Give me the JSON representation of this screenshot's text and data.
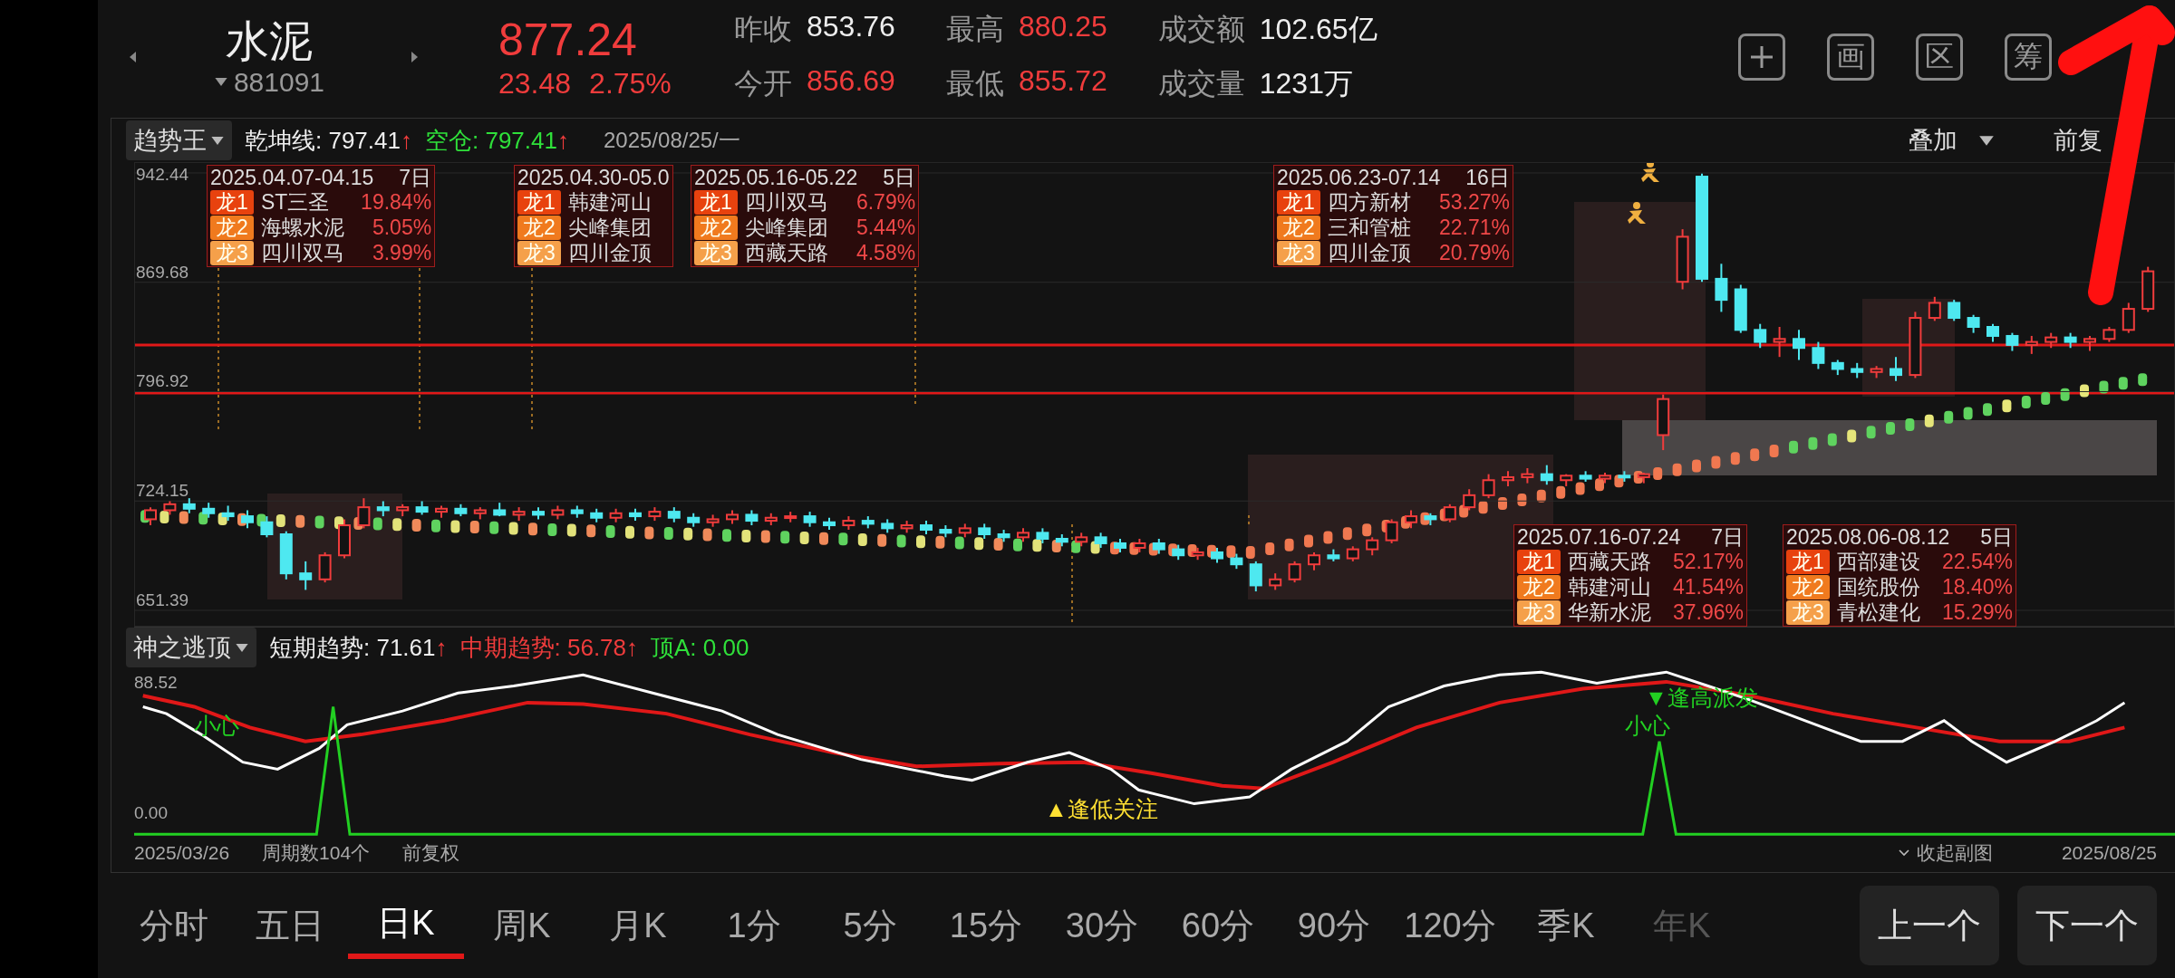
{
  "header": {
    "title": "水泥",
    "code": "881091",
    "price": "877.24",
    "change": "23.48",
    "change_pct": "2.75%",
    "stats": [
      {
        "label": "昨收",
        "value": "853.76",
        "kind": "flat"
      },
      {
        "label": "今开",
        "value": "856.69",
        "kind": "up"
      },
      {
        "label": "最高",
        "value": "880.25",
        "kind": "up"
      },
      {
        "label": "最低",
        "value": "855.72",
        "kind": "up"
      },
      {
        "label": "成交额",
        "value": "102.65亿",
        "kind": "flat"
      },
      {
        "label": "成交量",
        "value": "1231万",
        "kind": "flat"
      }
    ],
    "toolbar": [
      {
        "kind": "plus"
      },
      {
        "kind": "text",
        "label": "画"
      },
      {
        "kind": "text",
        "label": "区"
      },
      {
        "kind": "text",
        "label": "筹"
      }
    ]
  },
  "main_chart": {
    "indicator": "趋势王",
    "values": [
      {
        "label": "乾坤线:",
        "value": "797.41",
        "arrow": "↑",
        "kind": "white"
      },
      {
        "label": "空仓:",
        "value": "797.41",
        "arrow": "↑",
        "kind": "green"
      }
    ],
    "date": "2025/08/25/一",
    "overlay": "叠加",
    "adjust": "前复",
    "chart_data": {
      "type": "candlestick",
      "ylim": [
        640.54,
        949.67
      ],
      "yticks": [
        942.44,
        869.68,
        796.92,
        724.15,
        651.39
      ],
      "grid": true,
      "ohlc": [
        [
          712,
          720,
          708,
          718
        ],
        [
          718,
          724,
          715,
          722
        ],
        [
          722,
          726,
          716,
          719
        ],
        [
          719,
          723,
          713,
          716
        ],
        [
          716,
          721,
          711,
          714
        ],
        [
          714,
          718,
          706,
          710
        ],
        [
          710,
          714,
          700,
          702
        ],
        [
          702,
          704,
          672,
          676
        ],
        [
          676,
          684,
          665,
          672
        ],
        [
          672,
          690,
          670,
          688
        ],
        [
          688,
          712,
          686,
          708
        ],
        [
          708,
          726,
          706,
          720
        ],
        [
          720,
          724,
          714,
          718
        ],
        [
          718,
          722,
          714,
          720
        ],
        [
          720,
          724,
          715,
          717
        ],
        [
          717,
          721,
          713,
          719
        ],
        [
          719,
          722,
          714,
          716
        ],
        [
          716,
          720,
          712,
          718
        ],
        [
          718,
          723,
          714,
          715
        ],
        [
          715,
          720,
          711,
          717
        ],
        [
          717,
          720,
          712,
          715
        ],
        [
          715,
          721,
          712,
          718
        ],
        [
          718,
          721,
          713,
          716
        ],
        [
          716,
          719,
          710,
          713
        ],
        [
          713,
          719,
          710,
          716
        ],
        [
          716,
          719,
          711,
          714
        ],
        [
          714,
          720,
          711,
          717
        ],
        [
          717,
          720,
          710,
          713
        ],
        [
          713,
          716,
          707,
          710
        ],
        [
          710,
          715,
          707,
          712
        ],
        [
          712,
          718,
          709,
          715
        ],
        [
          715,
          718,
          708,
          711
        ],
        [
          711,
          716,
          708,
          713
        ],
        [
          713,
          717,
          710,
          714
        ],
        [
          714,
          717,
          707,
          710
        ],
        [
          710,
          713,
          705,
          708
        ],
        [
          708,
          714,
          705,
          711
        ],
        [
          711,
          714,
          706,
          709
        ],
        [
          709,
          712,
          703,
          706
        ],
        [
          706,
          711,
          703,
          708
        ],
        [
          708,
          711,
          702,
          705
        ],
        [
          705,
          708,
          700,
          703
        ],
        [
          703,
          709,
          700,
          706
        ],
        [
          706,
          709,
          699,
          702
        ],
        [
          702,
          705,
          697,
          700
        ],
        [
          700,
          706,
          697,
          703
        ],
        [
          703,
          706,
          696,
          699
        ],
        [
          699,
          702,
          694,
          697
        ],
        [
          697,
          703,
          694,
          700
        ],
        [
          700,
          703,
          693,
          696
        ],
        [
          696,
          699,
          690,
          693
        ],
        [
          693,
          699,
          690,
          696
        ],
        [
          696,
          699,
          689,
          692
        ],
        [
          692,
          695,
          685,
          688
        ],
        [
          688,
          693,
          685,
          690
        ],
        [
          690,
          693,
          683,
          686
        ],
        [
          686,
          689,
          679,
          682
        ],
        [
          682,
          684,
          664,
          668
        ],
        [
          668,
          676,
          665,
          672
        ],
        [
          672,
          684,
          670,
          682
        ],
        [
          682,
          690,
          678,
          688
        ],
        [
          688,
          692,
          684,
          686
        ],
        [
          686,
          694,
          684,
          692
        ],
        [
          692,
          700,
          688,
          698
        ],
        [
          698,
          712,
          696,
          710
        ],
        [
          710,
          718,
          706,
          714
        ],
        [
          714,
          716,
          708,
          712
        ],
        [
          712,
          722,
          710,
          720
        ],
        [
          720,
          732,
          718,
          728
        ],
        [
          728,
          742,
          726,
          738
        ],
        [
          738,
          744,
          734,
          740
        ],
        [
          740,
          746,
          736,
          742
        ],
        [
          742,
          748,
          735,
          738
        ],
        [
          738,
          742,
          734,
          741
        ],
        [
          741,
          744,
          737,
          739
        ],
        [
          739,
          743,
          736,
          741
        ],
        [
          741,
          744,
          737,
          740
        ],
        [
          740,
          743,
          736,
          742
        ],
        [
          768,
          795,
          758,
          792
        ],
        [
          870,
          905,
          865,
          900
        ],
        [
          940,
          942,
          870,
          872
        ],
        [
          872,
          882,
          850,
          858
        ],
        [
          865,
          868,
          836,
          838
        ],
        [
          838,
          842,
          826,
          830
        ],
        [
          830,
          840,
          820,
          832
        ],
        [
          832,
          838,
          818,
          826
        ],
        [
          826,
          830,
          812,
          816
        ],
        [
          816,
          818,
          808,
          812
        ],
        [
          812,
          816,
          806,
          810
        ],
        [
          810,
          814,
          806,
          812
        ],
        [
          812,
          820,
          804,
          808
        ],
        [
          808,
          850,
          806,
          846
        ],
        [
          846,
          860,
          844,
          856
        ],
        [
          856,
          858,
          844,
          846
        ],
        [
          846,
          848,
          836,
          840
        ],
        [
          840,
          842,
          830,
          834
        ],
        [
          834,
          836,
          824,
          828
        ],
        [
          828,
          834,
          822,
          830
        ],
        [
          830,
          836,
          826,
          833
        ],
        [
          833,
          836,
          826,
          830
        ],
        [
          830,
          834,
          824,
          832
        ],
        [
          832,
          840,
          830,
          838
        ],
        [
          838,
          856,
          836,
          852
        ],
        [
          852,
          880,
          850,
          877
        ]
      ]
    },
    "dragon_boxes": [
      {
        "range": "2025.04.07-04.15",
        "days": "7日",
        "rows": [
          {
            "rank": "龙1",
            "name": "ST三圣",
            "pct": "19.84%"
          },
          {
            "rank": "龙2",
            "name": "海螺水泥",
            "pct": "5.05%"
          },
          {
            "rank": "龙3",
            "name": "四川双马",
            "pct": "3.99%"
          }
        ]
      },
      {
        "range": "2025.04.30-05.0",
        "rows": [
          {
            "rank": "龙1",
            "name": "韩建河山"
          },
          {
            "rank": "龙2",
            "name": "尖峰集团"
          },
          {
            "rank": "龙3",
            "name": "四川金顶"
          }
        ]
      },
      {
        "range": "2025.05.16-05.22",
        "days": "5日",
        "rows": [
          {
            "rank": "龙1",
            "name": "四川双马",
            "pct": "6.79%"
          },
          {
            "rank": "龙2",
            "name": "尖峰集团",
            "pct": "5.44%"
          },
          {
            "rank": "龙3",
            "name": "西藏天路",
            "pct": "4.58%"
          }
        ]
      },
      {
        "range": "2025.06.23-07.14",
        "days": "16日",
        "rows": [
          {
            "rank": "龙1",
            "name": "四方新材",
            "pct": "53.27%"
          },
          {
            "rank": "龙2",
            "name": "三和管桩",
            "pct": "22.71%"
          },
          {
            "rank": "龙3",
            "name": "四川金顶",
            "pct": "20.79%"
          }
        ]
      },
      {
        "range": "2025.07.16-07.24",
        "days": "7日",
        "rows": [
          {
            "rank": "龙1",
            "name": "西藏天路",
            "pct": "52.17%"
          },
          {
            "rank": "龙2",
            "name": "韩建河山",
            "pct": "41.54%"
          },
          {
            "rank": "龙3",
            "name": "华新水泥",
            "pct": "37.96%"
          }
        ]
      },
      {
        "range": "2025.08.06-08.12",
        "days": "5日",
        "rows": [
          {
            "rank": "龙1",
            "name": "西部建设",
            "pct": "22.54%"
          },
          {
            "rank": "龙2",
            "name": "国统股份",
            "pct": "18.40%"
          },
          {
            "rank": "龙3",
            "name": "青松建化",
            "pct": "15.29%"
          }
        ]
      }
    ]
  },
  "sub_chart": {
    "indicator": "神之逃顶",
    "values": [
      {
        "label": "短期趋势:",
        "value": "71.61",
        "arrow": "↑",
        "kind": "white"
      },
      {
        "label": "中期趋势:",
        "value": "56.78",
        "arrow": "↑",
        "kind": "red"
      },
      {
        "label": "顶A:",
        "value": "0.00",
        "kind": "green"
      }
    ],
    "y_ticks": [
      "88.52",
      "0.00"
    ],
    "signals": [
      {
        "text": "小心",
        "kind": "warn"
      },
      {
        "text": "▲逢低关注",
        "kind": "buy"
      },
      {
        "text": "小心",
        "kind": "warn"
      },
      {
        "text": "▼逢高派发",
        "kind": "sell"
      }
    ]
  },
  "footer": {
    "start_date": "2025/03/26",
    "period_count": "周期数104个",
    "adjust": "前复权",
    "collapse": "收起副图",
    "end_date": "2025/08/25"
  },
  "periods": [
    {
      "label": "分时",
      "selected": false,
      "disabled": false
    },
    {
      "label": "五日",
      "selected": false,
      "disabled": false
    },
    {
      "label": "日K",
      "selected": true,
      "disabled": false
    },
    {
      "label": "周K",
      "selected": false,
      "disabled": false
    },
    {
      "label": "月K",
      "selected": false,
      "disabled": false
    },
    {
      "label": "1分",
      "selected": false,
      "disabled": false
    },
    {
      "label": "5分",
      "selected": false,
      "disabled": false
    },
    {
      "label": "15分",
      "selected": false,
      "disabled": false
    },
    {
      "label": "30分",
      "selected": false,
      "disabled": false
    },
    {
      "label": "60分",
      "selected": false,
      "disabled": false
    },
    {
      "label": "90分",
      "selected": false,
      "disabled": false
    },
    {
      "label": "120分",
      "selected": false,
      "disabled": false
    },
    {
      "label": "季K",
      "selected": false,
      "disabled": false
    },
    {
      "label": "年K",
      "selected": false,
      "disabled": true
    }
  ],
  "nav_buttons": [
    "上一个",
    "下一个"
  ]
}
